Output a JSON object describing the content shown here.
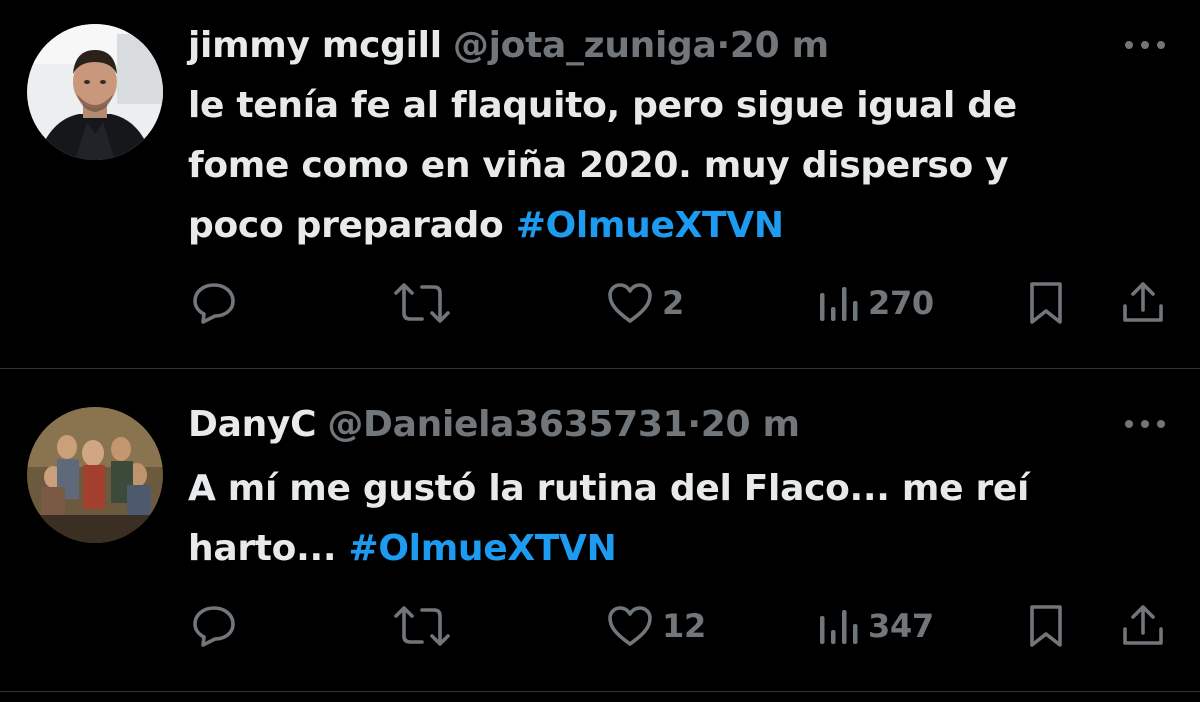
{
  "colors": {
    "background": "#000000",
    "primary_text": "#e7e9ea",
    "secondary_text": "#71767b",
    "hashtag": "#1d9bf0",
    "divider": "#2f3336"
  },
  "icons": {
    "reply": "reply-icon",
    "repost": "repost-icon",
    "like": "heart-icon",
    "views": "views-chart-icon",
    "bookmark": "bookmark-icon",
    "share": "share-icon",
    "more": "more-dots-icon"
  },
  "tweets": [
    {
      "display_name": "jimmy mcgill",
      "handle": "@jota_zuniga",
      "separator": "·",
      "time": "20 m",
      "text_lines": [
        "le tenía fe al flaquito, pero sigue igual de",
        "fome como en viña 2020. muy disperso y",
        "poco preparado "
      ],
      "hashtag": "#OlmueXTVN",
      "likes": "2",
      "views": "270"
    },
    {
      "display_name": "DanyC",
      "handle": "@Daniela3635731",
      "separator": "·",
      "time": "20 m",
      "text_lines": [
        "A mí me gustó la rutina del Flaco... me reí",
        "harto... "
      ],
      "hashtag": "#OlmueXTVN",
      "likes": "12",
      "views": "347"
    }
  ]
}
